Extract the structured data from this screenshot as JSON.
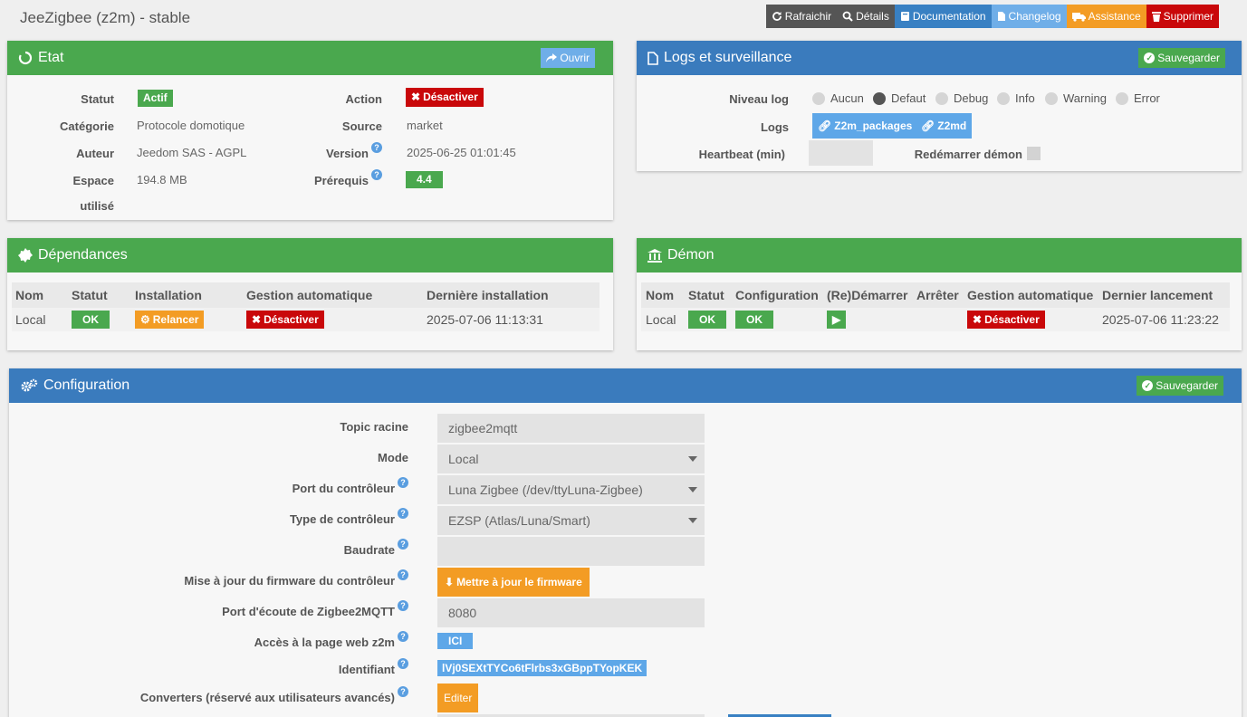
{
  "header": {
    "title": "JeeZigbee (z2m) - stable"
  },
  "topbar": {
    "refresh": "Rafraichir",
    "details": "Détails",
    "documentation": "Documentation",
    "changelog": "Changelog",
    "assistance": "Assistance",
    "delete": "Supprimer"
  },
  "etat": {
    "title": "Etat",
    "open": "Ouvrir",
    "statut_label": "Statut",
    "statut_value": "Actif",
    "categorie_label": "Catégorie",
    "categorie_value": "Protocole domotique",
    "auteur_label": "Auteur",
    "auteur_value": "Jeedom SAS - AGPL",
    "espace_label": "Espace",
    "espace_label2": "utilisé",
    "espace_value": "194.8 MB",
    "action_label": "Action",
    "action_value": "Désactiver",
    "source_label": "Source",
    "source_value": "market",
    "version_label": "Version",
    "version_value": "2025-06-25 01:01:45",
    "prerequis_label": "Prérequis",
    "prerequis_value": "4.4"
  },
  "logs": {
    "title": "Logs et surveillance",
    "save": "Sauvegarder",
    "niveau_label": "Niveau log",
    "levels": [
      "Aucun",
      "Defaut",
      "Debug",
      "Info",
      "Warning",
      "Error"
    ],
    "selected_level": "Defaut",
    "logs_label": "Logs",
    "log_btn1": "Z2m_packages",
    "log_btn2": "Z2md",
    "heartbeat_label": "Heartbeat (min)",
    "heartbeat_value": "",
    "restart_label": "Redémarrer démon"
  },
  "dependances": {
    "title": "Dépendances",
    "headers": [
      "Nom",
      "Statut",
      "Installation",
      "Gestion automatique",
      "Dernière installation"
    ],
    "row": {
      "nom": "Local",
      "statut": "OK",
      "installation": "Relancer",
      "gestion": "Désactiver",
      "derniere": "2025-07-06 11:13:31"
    }
  },
  "demon": {
    "title": "Démon",
    "headers": [
      "Nom",
      "Statut",
      "Configuration",
      "(Re)Démarrer",
      "Arrêter",
      "Gestion automatique",
      "Dernier lancement"
    ],
    "row": {
      "nom": "Local",
      "statut": "OK",
      "configuration": "OK",
      "gestion": "Désactiver",
      "dernier": "2025-07-06 11:23:22"
    }
  },
  "configuration": {
    "title": "Configuration",
    "save": "Sauvegarder",
    "topic_label": "Topic racine",
    "topic_value": "zigbee2mqtt",
    "mode_label": "Mode",
    "mode_value": "Local",
    "port_label": "Port du contrôleur",
    "port_value": "Luna Zigbee (/dev/ttyLuna-Zigbee)",
    "type_label": "Type de contrôleur",
    "type_value": "EZSP (Atlas/Luna/Smart)",
    "baudrate_label": "Baudrate",
    "baudrate_value": "",
    "firmware_label": "Mise à jour du firmware du contrôleur",
    "firmware_btn": "Mettre à jour le firmware",
    "listen_label": "Port d'écoute de Zigbee2MQTT",
    "listen_value": "8080",
    "web_label": "Accès à la page web z2m",
    "web_btn": "ICI",
    "id_label": "Identifiant",
    "id_value": "lVj0SEXtTYCo6tFlrbs3xGBppTYopKEK",
    "conv_label": "Converters (réservé aux utilisateurs avancés)",
    "conv_btn": "Editer"
  },
  "colors": {
    "green": "#4aa84e",
    "blue": "#3a7bbd",
    "red": "#c9080a",
    "orange": "#f39c24"
  }
}
